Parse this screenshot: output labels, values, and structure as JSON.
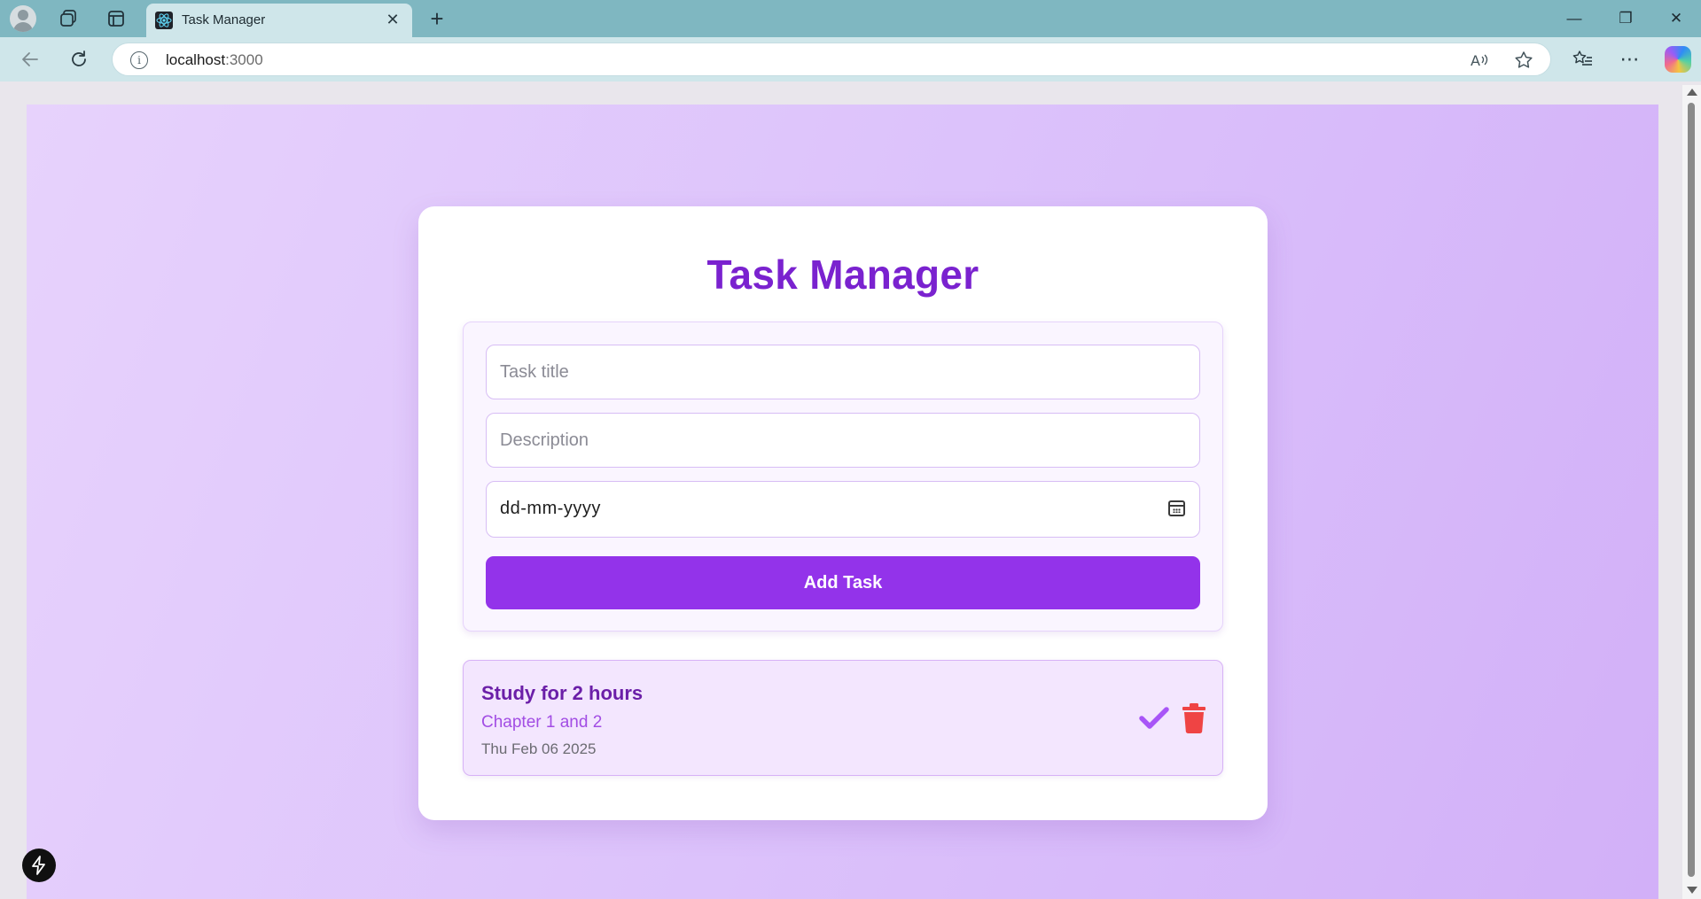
{
  "browser": {
    "tab_title": "Task Manager",
    "tab_close_glyph": "✕",
    "new_tab_glyph": "+",
    "url_host": "localhost",
    "url_port": ":3000",
    "window_controls": {
      "minimize": "—",
      "restore": "❐",
      "close": "✕"
    },
    "icons": [
      "profile-icon",
      "workspaces-icon",
      "tab-actions-icon",
      "react-favicon",
      "back-icon",
      "refresh-icon",
      "site-info-icon",
      "read-aloud-icon",
      "favorite-star-icon",
      "favorites-icon",
      "more-icon",
      "copilot-icon"
    ]
  },
  "app": {
    "title": "Task Manager",
    "form": {
      "title_placeholder": "Task title",
      "description_placeholder": "Description",
      "date_value": "dd-mm-yyyy",
      "submit_label": "Add Task"
    },
    "tasks": [
      {
        "title": "Study for 2 hours",
        "description": "Chapter 1 and 2",
        "date": "Thu Feb 06 2025"
      }
    ],
    "colors": {
      "accent": "#9333ea",
      "title": "#7a22cf",
      "complete": "#a855f7",
      "delete": "#ef4444"
    }
  }
}
